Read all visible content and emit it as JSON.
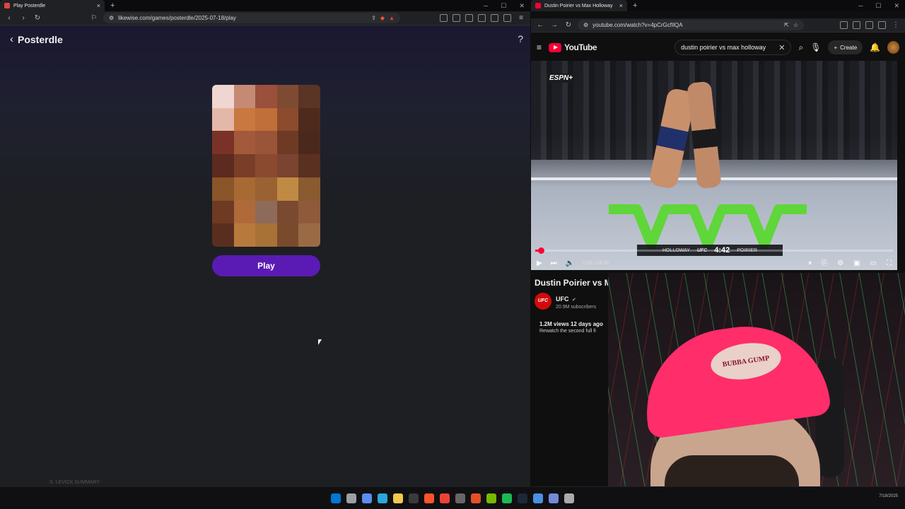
{
  "left_browser": {
    "tab_title": "Play Posterdle",
    "url": "likewise.com/games/posterdle/2025-07-18/play",
    "page": {
      "title": "Posterdle",
      "help": "?",
      "play_label": "Play"
    },
    "poster_colors": [
      "#f0d6d0",
      "#c48a74",
      "#9a503a",
      "#7e4a32",
      "#5a3425",
      "#e4b8a8",
      "#c9783f",
      "#c06e3a",
      "#8b4b2c",
      "#4e2a1d",
      "#7a3228",
      "#a35a3a",
      "#9a5438",
      "#6e3a24",
      "#4a291c",
      "#5c2a1e",
      "#7a3e28",
      "#8a4a30",
      "#7a4430",
      "#5a3020",
      "#8a5528",
      "#a86a34",
      "#9a6232",
      "#c08a44",
      "#8a5a30",
      "#6e3a22",
      "#b06a3a",
      "#8e6a5a",
      "#7a4a30",
      "#8e5a3a",
      "#5a2e1e",
      "#b87a3c",
      "#a87236",
      "#7a4a2c",
      "#9a6a44"
    ],
    "footer_text": "S. LEVICK SUMMARY"
  },
  "right_browser": {
    "tab_title": "Dustin Poirier vs Max Holloway",
    "url": "youtube.com/watch?v=4pCrGcfIlQA",
    "youtube": {
      "logo_text": "YouTube",
      "search_value": "dustin poirier vs max holloway",
      "create_label": "Create",
      "video": {
        "network": "ESPN+",
        "scorebug_left": "HOLLOWAY",
        "scorebug_org": "UFC",
        "scorebug_clock": "4:42",
        "scorebug_right": "POIRIER",
        "time_display": "0:26 / 28:46",
        "progress_fraction": 0.015
      },
      "title": "Dustin Poirier vs Ma",
      "channel": {
        "logo": "UFC",
        "name": "UFC",
        "subscribers": "20.9M subscribers"
      },
      "meta": "1.2M views  12 days ago",
      "description": "Rewatch the second full fi"
    }
  },
  "webcam": {
    "hat_text": "BUBBA GUMP"
  },
  "taskbar": {
    "apps": [
      "#0078d4",
      "#9aa0a6",
      "#5a8dee",
      "#2aa7d8",
      "#f2c94c",
      "#3a3a3a",
      "#fb542b",
      "#ea4335",
      "#666",
      "#e34f26",
      "#76b900",
      "#1db954",
      "#1b2838",
      "#4a90e2",
      "#7289da",
      "#aaa"
    ],
    "clock": "7/18/2025"
  }
}
